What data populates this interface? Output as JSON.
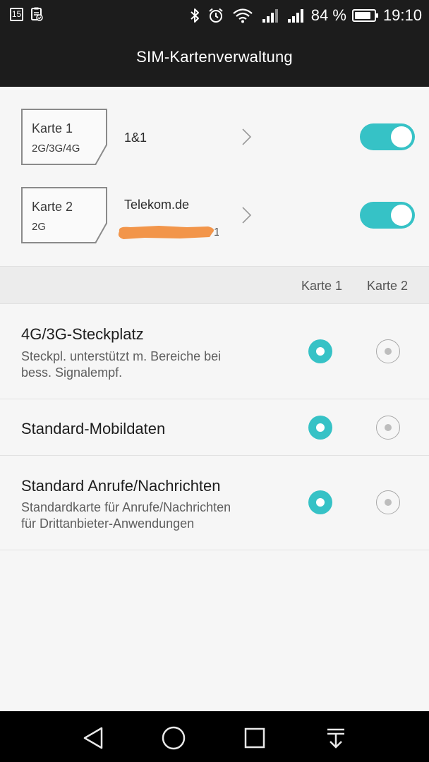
{
  "status_bar": {
    "date_badge": "15",
    "battery_percent": "84 %",
    "battery_level": 0.84,
    "time": "19:10",
    "icons": [
      "calendar-icon",
      "clipboard-icon",
      "bluetooth-icon",
      "alarm-icon",
      "wifi-icon",
      "signal-icon",
      "signal-icon",
      "battery-icon"
    ]
  },
  "header": {
    "title": "SIM-Kartenverwaltung"
  },
  "sims": [
    {
      "card": "Karte 1",
      "network": "2G/3G/4G",
      "operator": "1&1",
      "enabled": true
    },
    {
      "card": "Karte 2",
      "network": "2G",
      "operator": "Telekom.de",
      "enabled": true
    }
  ],
  "columns": {
    "karte1": "Karte 1",
    "karte2": "Karte 2"
  },
  "settings": [
    {
      "title": "4G/3G-Steckplatz",
      "subtitle_line1": "Steckpl. unterstützt m. Bereiche bei",
      "subtitle_line2": "bess. Signalempf.",
      "selected": "Karte 1"
    },
    {
      "title": "Standard-Mobildaten",
      "selected": "Karte 1"
    },
    {
      "title": "Standard Anrufe/Nachrichten",
      "subtitle_line1": "Standardkarte für Anrufe/Nachrichten",
      "subtitle_line2": "für Drittanbieter-Anwendungen",
      "selected": "Karte 1"
    }
  ],
  "colors": {
    "accent": "#36c2c6",
    "header_bg": "#1c1c1c",
    "page_bg": "#f6f6f6",
    "redaction": "#f2954a"
  },
  "nav_bar": {
    "icons": [
      "back-icon",
      "home-icon",
      "recents-icon",
      "notification-pull-icon"
    ]
  }
}
